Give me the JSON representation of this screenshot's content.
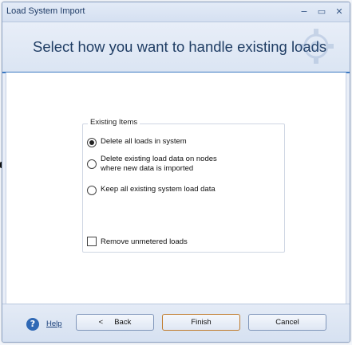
{
  "window": {
    "title": "Load System Import",
    "minimize_glyph": "−",
    "maximize_glyph": "▭",
    "close_glyph": "✕"
  },
  "header": {
    "title": "Select how you want to handle existing loads",
    "watermark_icon": "gear-icon"
  },
  "group": {
    "legend": "Existing Items",
    "options": [
      {
        "label": "Delete all loads in system",
        "checked": true
      },
      {
        "label": "Delete existing load data on nodes\nwhere new data is imported",
        "checked": false
      },
      {
        "label": "Keep all existing system load data",
        "checked": false
      }
    ],
    "checkbox": {
      "label": "Remove unmetered loads",
      "checked": false
    }
  },
  "footer": {
    "help_icon": "help-icon",
    "help_glyph": "?",
    "help_label": "Help",
    "back_arrow": "<",
    "back_label": "Back",
    "finish_label": "Finish",
    "cancel_label": "Cancel"
  },
  "colors": {
    "accent": "#3a78c2",
    "title_text": "#1f3d64",
    "finish_border": "#c07b2c"
  }
}
